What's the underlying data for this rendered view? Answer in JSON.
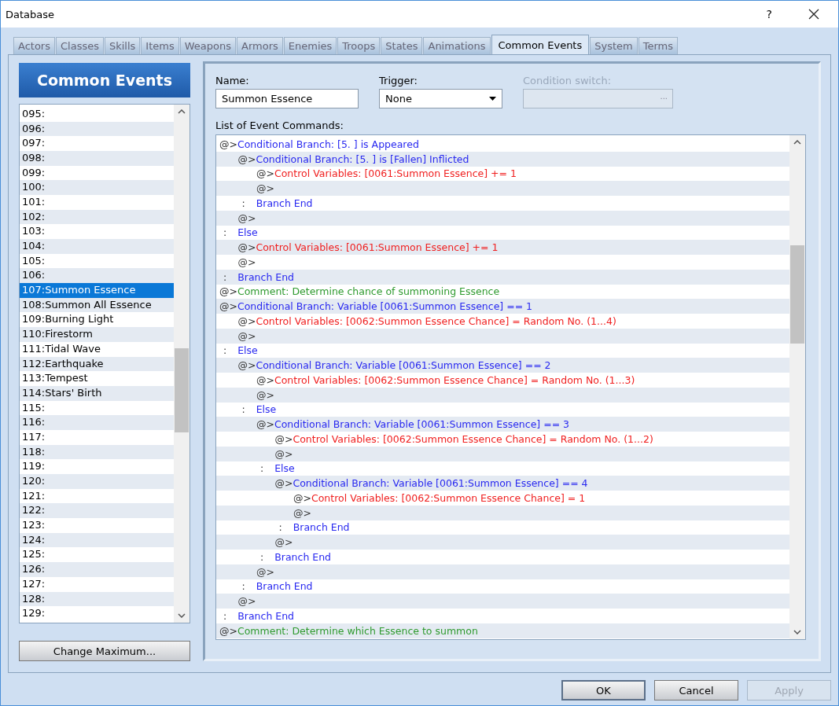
{
  "window": {
    "title": "Database",
    "help_button": "?"
  },
  "tabs": [
    {
      "label": "Actors",
      "selected": false
    },
    {
      "label": "Classes",
      "selected": false
    },
    {
      "label": "Skills",
      "selected": false
    },
    {
      "label": "Items",
      "selected": false
    },
    {
      "label": "Weapons",
      "selected": false
    },
    {
      "label": "Armors",
      "selected": false
    },
    {
      "label": "Enemies",
      "selected": false
    },
    {
      "label": "Troops",
      "selected": false
    },
    {
      "label": "States",
      "selected": false
    },
    {
      "label": "Animations",
      "selected": false
    },
    {
      "label": "Common Events",
      "selected": true
    },
    {
      "label": "System",
      "selected": false
    },
    {
      "label": "Terms",
      "selected": false
    }
  ],
  "sidebar": {
    "title": "Common Events",
    "items": [
      {
        "label": "095:",
        "selected": false
      },
      {
        "label": "096:",
        "selected": false
      },
      {
        "label": "097:",
        "selected": false
      },
      {
        "label": "098:",
        "selected": false
      },
      {
        "label": "099:",
        "selected": false
      },
      {
        "label": "100:",
        "selected": false
      },
      {
        "label": "101:",
        "selected": false
      },
      {
        "label": "102:",
        "selected": false
      },
      {
        "label": "103:",
        "selected": false
      },
      {
        "label": "104:",
        "selected": false
      },
      {
        "label": "105:",
        "selected": false
      },
      {
        "label": "106:",
        "selected": false
      },
      {
        "label": "107:Summon Essence",
        "selected": true
      },
      {
        "label": "108:Summon All Essence",
        "selected": false
      },
      {
        "label": "109:Burning Light",
        "selected": false
      },
      {
        "label": "110:Firestorm",
        "selected": false
      },
      {
        "label": "111:Tidal Wave",
        "selected": false
      },
      {
        "label": "112:Earthquake",
        "selected": false
      },
      {
        "label": "113:Tempest",
        "selected": false
      },
      {
        "label": "114:Stars' Birth",
        "selected": false
      },
      {
        "label": "115:",
        "selected": false
      },
      {
        "label": "116:",
        "selected": false
      },
      {
        "label": "117:",
        "selected": false
      },
      {
        "label": "118:",
        "selected": false
      },
      {
        "label": "119:",
        "selected": false
      },
      {
        "label": "120:",
        "selected": false
      },
      {
        "label": "121:",
        "selected": false
      },
      {
        "label": "122:",
        "selected": false
      },
      {
        "label": "123:",
        "selected": false
      },
      {
        "label": "124:",
        "selected": false
      },
      {
        "label": "125:",
        "selected": false
      },
      {
        "label": "126:",
        "selected": false
      },
      {
        "label": "127:",
        "selected": false
      },
      {
        "label": "128:",
        "selected": false
      },
      {
        "label": "129:",
        "selected": false
      }
    ],
    "button": "Change Maximum..."
  },
  "name_field": {
    "label": "Name:",
    "value": "Summon Essence"
  },
  "trigger": {
    "label": "Trigger:",
    "value": "None"
  },
  "condition_switch": {
    "label": "Condition switch:",
    "button_label": "...",
    "disabled": true
  },
  "commands": {
    "label": "List of Event Commands:",
    "items": [
      {
        "kind": "branch",
        "prefix": "@>",
        "text": "Conditional Branch: [5. ] is Appeared",
        "children": [
          {
            "kind": "branch",
            "prefix": "@>",
            "text": "Conditional Branch: [5. ] is [Fallen] Inflicted",
            "children": [
              {
                "kind": "control",
                "prefix": "@>",
                "text": "Control Variables: [0061:Summon Essence] += 1"
              },
              {
                "kind": "blank",
                "prefix": "@>"
              }
            ]
          },
          {
            "kind": "end",
            "prefix": ":",
            "text": "Branch End"
          },
          {
            "kind": "blank",
            "prefix": "@>"
          }
        ]
      },
      {
        "kind": "else",
        "prefix": ":",
        "text": "Else",
        "children": [
          {
            "kind": "control",
            "prefix": "@>",
            "text": "Control Variables: [0061:Summon Essence] += 1"
          },
          {
            "kind": "blank",
            "prefix": "@>"
          }
        ]
      },
      {
        "kind": "end",
        "prefix": ":",
        "text": "Branch End"
      },
      {
        "kind": "comment",
        "prefix": "@>",
        "text": "Comment: Determine chance of summoning Essence"
      },
      {
        "kind": "branch",
        "prefix": "@>",
        "text": "Conditional Branch: Variable [0061:Summon Essence] == 1",
        "children": [
          {
            "kind": "control",
            "prefix": "@>",
            "text": "Control Variables: [0062:Summon Essence Chance] = Random No. (1...4)"
          },
          {
            "kind": "blank",
            "prefix": "@>"
          }
        ]
      },
      {
        "kind": "else",
        "prefix": ":",
        "text": "Else",
        "children": [
          {
            "kind": "branch",
            "prefix": "@>",
            "text": "Conditional Branch: Variable [0061:Summon Essence] == 2",
            "children": [
              {
                "kind": "control",
                "prefix": "@>",
                "text": "Control Variables: [0062:Summon Essence Chance] = Random No. (1...3)"
              },
              {
                "kind": "blank",
                "prefix": "@>"
              }
            ]
          },
          {
            "kind": "else",
            "prefix": ":",
            "text": "Else",
            "children": [
              {
                "kind": "branch",
                "prefix": "@>",
                "text": "Conditional Branch: Variable [0061:Summon Essence] == 3",
                "children": [
                  {
                    "kind": "control",
                    "prefix": "@>",
                    "text": "Control Variables: [0062:Summon Essence Chance] = Random No. (1...2)"
                  },
                  {
                    "kind": "blank",
                    "prefix": "@>"
                  }
                ]
              },
              {
                "kind": "else",
                "prefix": ":",
                "text": "Else",
                "children": [
                  {
                    "kind": "branch",
                    "prefix": "@>",
                    "text": "Conditional Branch: Variable [0061:Summon Essence] == 4",
                    "children": [
                      {
                        "kind": "control",
                        "prefix": "@>",
                        "text": "Control Variables: [0062:Summon Essence Chance] = 1"
                      },
                      {
                        "kind": "blank",
                        "prefix": "@>"
                      }
                    ]
                  },
                  {
                    "kind": "end",
                    "prefix": ":",
                    "text": "Branch End"
                  },
                  {
                    "kind": "blank",
                    "prefix": "@>"
                  }
                ]
              },
              {
                "kind": "end",
                "prefix": ":",
                "text": "Branch End"
              },
              {
                "kind": "blank",
                "prefix": "@>"
              }
            ]
          },
          {
            "kind": "end",
            "prefix": ":",
            "text": "Branch End"
          },
          {
            "kind": "blank",
            "prefix": "@>"
          }
        ]
      },
      {
        "kind": "end",
        "prefix": ":",
        "text": "Branch End"
      },
      {
        "kind": "comment",
        "prefix": "@>",
        "text": "Comment: Determine which Essence to summon"
      }
    ]
  },
  "buttons": [
    {
      "label": "OK",
      "kind": "default",
      "disabled": false
    },
    {
      "label": "Cancel",
      "kind": "normal",
      "disabled": false
    },
    {
      "label": "Apply",
      "kind": "normal",
      "disabled": true
    }
  ]
}
